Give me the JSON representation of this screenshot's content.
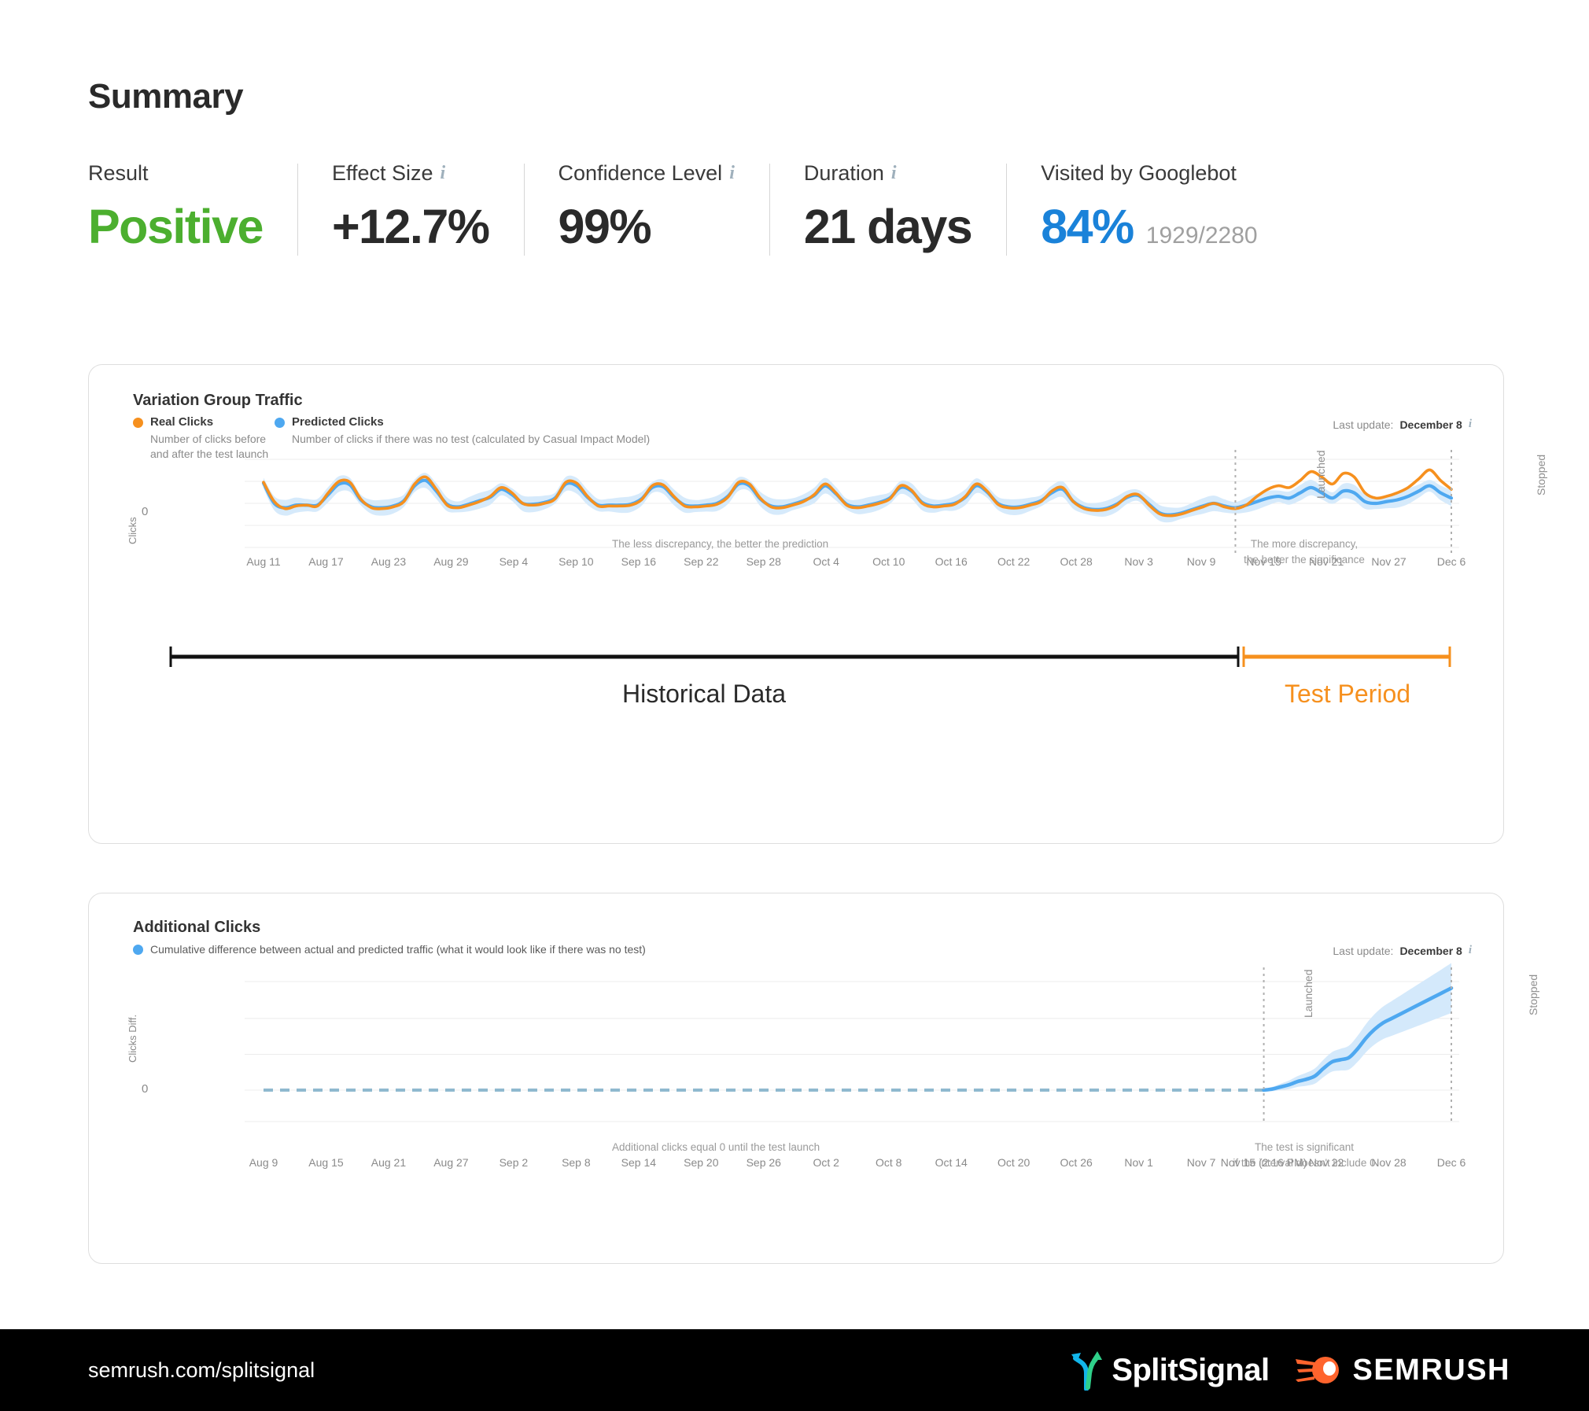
{
  "summary": {
    "title": "Summary",
    "stats": [
      {
        "label": "Result",
        "info": false,
        "value": "Positive",
        "color": "green",
        "sub": ""
      },
      {
        "label": "Effect Size",
        "info": true,
        "value": "+12.7%",
        "color": "dark",
        "sub": ""
      },
      {
        "label": "Confidence Level",
        "info": true,
        "value": "99%",
        "color": "dark",
        "sub": ""
      },
      {
        "label": "Duration",
        "info": true,
        "value": "21 days",
        "color": "dark",
        "sub": ""
      },
      {
        "label": "Visited by Googlebot",
        "info": false,
        "value": "84%",
        "color": "blue",
        "sub": "1929/2280"
      }
    ]
  },
  "traffic_card": {
    "title": "Variation Group Traffic",
    "legend": [
      {
        "name": "Real Clicks",
        "desc": "Number of clicks before\nand after the test launch",
        "color": "#f6901e"
      },
      {
        "name": "Predicted Clicks",
        "desc": "Number of clicks if there was no test\n(calculated by Casual Impact Model)",
        "color": "#4ea8f0"
      }
    ],
    "last_update_prefix": "Last update:",
    "last_update_value": "December 8",
    "y_axis_label": "Clicks",
    "zero_label": "0",
    "marker_launched": "Launched",
    "marker_stopped": "Stopped",
    "note_left": "The less discrepancy, the better the prediction",
    "note_right": "The more discrepancy,\nthe better the significance",
    "period_historical": "Historical Data",
    "period_test": "Test Period"
  },
  "additional_card": {
    "title": "Additional Clicks",
    "legend_desc": "Cumulative difference between actual and predicted traffic (what it would look like if there was no test)",
    "legend_color": "#4ea8f0",
    "last_update_prefix": "Last update:",
    "last_update_value": "December 8",
    "y_axis_label": "Clicks Diff.",
    "zero_label": "0",
    "marker_launched": "Launched",
    "marker_stopped": "Stopped",
    "note_left": "Additional clicks equal 0 until the test launch",
    "note_right": "The test is significant\nif the interval doesn't include 0"
  },
  "footer": {
    "url": "semrush.com/splitsignal",
    "splitsignal_text": "SplitSignal",
    "semrush_text": "SEMRUSH"
  },
  "chart_data": [
    {
      "type": "line",
      "title": "Variation Group Traffic",
      "xlabel": "",
      "ylabel": "Clicks",
      "ylim": [
        0,
        100
      ],
      "grid": true,
      "legend_position": "top-left",
      "xtick_labels": [
        "Aug 11",
        "Aug 17",
        "Aug 23",
        "Aug 29",
        "Sep 4",
        "Sep 10",
        "Sep 16",
        "Sep 22",
        "Sep 28",
        "Oct 4",
        "Oct 10",
        "Oct 16",
        "Oct 22",
        "Oct 28",
        "Nov 3",
        "Nov 9",
        "Nov 15",
        "Nov 21",
        "Nov 27",
        "Dec 6"
      ],
      "annotations": [
        {
          "text": "Launched",
          "x_label": "Nov 15"
        },
        {
          "text": "Stopped",
          "x_label": "Dec 6"
        }
      ],
      "series": [
        {
          "name": "Real Clicks",
          "color": "#f6901e",
          "values": [
            74,
            52,
            44,
            47,
            48,
            47,
            62,
            75,
            74,
            55,
            45,
            44,
            46,
            52,
            72,
            80,
            66,
            48,
            45,
            48,
            52,
            58,
            68,
            62,
            50,
            48,
            50,
            55,
            74,
            73,
            58,
            47,
            47,
            47,
            48,
            54,
            70,
            71,
            58,
            47,
            46,
            47,
            49,
            57,
            74,
            72,
            56,
            46,
            45,
            48,
            52,
            60,
            72,
            62,
            48,
            45,
            47,
            50,
            55,
            70,
            65,
            50,
            46,
            47,
            49,
            58,
            72,
            64,
            49,
            45,
            45,
            48,
            52,
            64,
            68,
            52,
            44,
            42,
            43,
            48,
            58,
            60,
            48,
            38,
            36,
            38,
            42,
            46,
            50,
            46,
            44,
            48,
            58,
            66,
            70,
            68,
            76,
            86,
            80,
            72,
            84,
            80,
            62,
            56,
            58,
            62,
            68,
            78,
            88,
            76,
            66
          ]
        },
        {
          "name": "Predicted Clicks",
          "color": "#4ea8f0",
          "values": [
            73,
            50,
            45,
            48,
            48,
            48,
            60,
            72,
            71,
            54,
            46,
            45,
            47,
            53,
            70,
            76,
            64,
            49,
            46,
            49,
            53,
            57,
            66,
            60,
            50,
            49,
            51,
            56,
            72,
            70,
            57,
            48,
            48,
            48,
            49,
            55,
            68,
            69,
            57,
            48,
            47,
            48,
            50,
            58,
            72,
            70,
            55,
            47,
            46,
            49,
            53,
            59,
            70,
            61,
            49,
            46,
            48,
            51,
            56,
            68,
            64,
            51,
            47,
            48,
            50,
            57,
            70,
            63,
            50,
            46,
            46,
            49,
            53,
            62,
            66,
            52,
            45,
            43,
            44,
            49,
            57,
            59,
            49,
            39,
            37,
            39,
            43,
            47,
            50,
            47,
            45,
            48,
            52,
            56,
            58,
            56,
            62,
            68,
            62,
            56,
            64,
            62,
            52,
            50,
            52,
            54,
            58,
            64,
            70,
            62,
            56
          ]
        }
      ],
      "confidence_band": {
        "color": "#cfe6fb",
        "around": "Predicted Clicks"
      }
    },
    {
      "type": "line",
      "title": "Additional Clicks",
      "xlabel": "",
      "ylabel": "Clicks Diff.",
      "grid": true,
      "legend_position": "top-left",
      "xtick_labels": [
        "Aug 9",
        "Aug 15",
        "Aug 21",
        "Aug 27",
        "Sep 2",
        "Sep 8",
        "Sep 14",
        "Sep 20",
        "Sep 26",
        "Oct 2",
        "Oct 8",
        "Oct 14",
        "Oct 20",
        "Oct 26",
        "Nov 1",
        "Nov 7",
        "Nov 15 (2:16 PM)",
        "Nov 22",
        "Nov 28",
        "Dec 6"
      ],
      "annotations": [
        {
          "text": "Launched",
          "x_label": "Nov 15 (2:16 PM)"
        },
        {
          "text": "Stopped",
          "x_label": "Dec 6"
        }
      ],
      "series": [
        {
          "name": "Cumulative difference",
          "color": "#4ea8f0",
          "pre_launch_value": 0,
          "post_launch_values": [
            0,
            1,
            3,
            5,
            8,
            10,
            13,
            20,
            26,
            28,
            30,
            38,
            48,
            56,
            62,
            66,
            70,
            74,
            78,
            82,
            86,
            90,
            94
          ]
        }
      ],
      "confidence_band": {
        "color": "#cfe6fb",
        "around": "Cumulative difference"
      }
    }
  ]
}
